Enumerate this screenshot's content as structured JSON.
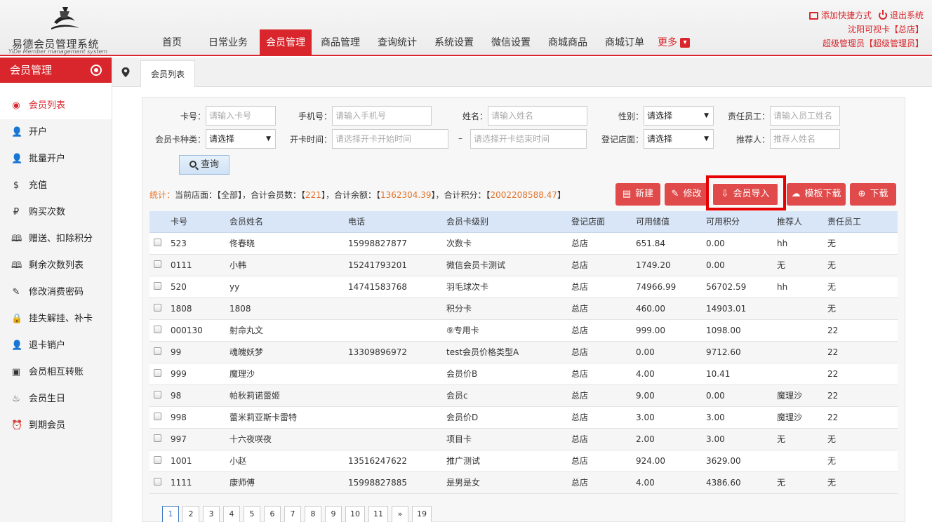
{
  "app": {
    "title": "易德会员管理系统",
    "subtitle": "YiDe Member management system"
  },
  "nav": [
    {
      "label": "首页",
      "active": false
    },
    {
      "label": "日常业务",
      "active": false
    },
    {
      "label": "会员管理",
      "active": true
    },
    {
      "label": "商品管理",
      "active": false
    },
    {
      "label": "查询统计",
      "active": false
    },
    {
      "label": "系统设置",
      "active": false
    },
    {
      "label": "微信设置",
      "active": false
    },
    {
      "label": "商城商品",
      "active": false
    },
    {
      "label": "商城订单",
      "active": false
    }
  ],
  "nav_more": "更多",
  "top_right": {
    "shortcut": "添加快捷方式",
    "logout": "退出系统",
    "store": "沈阳可视卡【总店】",
    "admin": "超级管理员【超级管理员】"
  },
  "sidebar": {
    "title": "会员管理",
    "items": [
      {
        "label": "会员列表",
        "icon": "record-icon",
        "glyph": "◉",
        "active": true
      },
      {
        "label": "开户",
        "icon": "user-icon",
        "glyph": "👤",
        "active": false
      },
      {
        "label": "批量开户",
        "icon": "user-icon",
        "glyph": "👤",
        "active": false
      },
      {
        "label": "充值",
        "icon": "coin-icon",
        "glyph": "$",
        "active": false
      },
      {
        "label": "购买次数",
        "icon": "p-coin-icon",
        "glyph": "₽",
        "active": false
      },
      {
        "label": "赠送、扣除积分",
        "icon": "book-icon",
        "glyph": "🕮",
        "active": false
      },
      {
        "label": "剩余次数列表",
        "icon": "book-icon",
        "glyph": "🕮",
        "active": false
      },
      {
        "label": "修改消费密码",
        "icon": "pencil-icon",
        "glyph": "✎",
        "active": false
      },
      {
        "label": "挂失解挂、补卡",
        "icon": "lock-icon",
        "glyph": "🔒",
        "active": false
      },
      {
        "label": "退卡销户",
        "icon": "user-icon",
        "glyph": "👤",
        "active": false
      },
      {
        "label": "会员相互转账",
        "icon": "image-icon",
        "glyph": "▣",
        "active": false
      },
      {
        "label": "会员生日",
        "icon": "cake-icon",
        "glyph": "♨",
        "active": false
      },
      {
        "label": "到期会员",
        "icon": "alarm-icon",
        "glyph": "⏰",
        "active": false
      }
    ]
  },
  "tab": {
    "label": "会员列表"
  },
  "filters": {
    "card_no": {
      "label": "卡号：",
      "placeholder": "请输入卡号"
    },
    "phone": {
      "label": "手机号：",
      "placeholder": "请输入手机号"
    },
    "name": {
      "label": "姓名：",
      "placeholder": "请输入姓名"
    },
    "gender": {
      "label": "性别：",
      "value": "请选择"
    },
    "staff": {
      "label": "责任员工：",
      "placeholder": "请输入员工姓名"
    },
    "card_type": {
      "label": "会员卡种类：",
      "value": "请选择"
    },
    "open_time": {
      "label": "开卡时间：",
      "start_placeholder": "请选择开卡开始时间",
      "end_placeholder": "请选择开卡结束时间",
      "sep": "–"
    },
    "store": {
      "label": "登记店面：",
      "value": "请选择"
    },
    "referrer": {
      "label": "推荐人：",
      "placeholder": "推荐人姓名"
    },
    "query_button": "查询"
  },
  "stats": {
    "label": "统计：",
    "store_text": "当前店面：【全部】，合计会员数：【",
    "member_count": "221",
    "balance_text": "】，合计余额：【",
    "balance": "1362304.39",
    "points_text": "】，合计积分：【",
    "points": "2002208588.47",
    "end": "】"
  },
  "actions": {
    "new": "新建",
    "edit": "修改",
    "import": "会员导入",
    "template": "模板下载",
    "download": "下载"
  },
  "table": {
    "headers": [
      "卡号",
      "会员姓名",
      "电话",
      "会员卡级别",
      "登记店面",
      "可用储值",
      "可用积分",
      "推荐人",
      "责任员工"
    ],
    "rows": [
      [
        "523",
        "佟春晓",
        "15998827877",
        "次数卡",
        "总店",
        "651.84",
        "0.00",
        "hh",
        "无"
      ],
      [
        "0111",
        "小韩",
        "15241793201",
        "微信会员卡测试",
        "总店",
        "1749.20",
        "0.00",
        "无",
        "无"
      ],
      [
        "520",
        "yy",
        "14741583768",
        "羽毛球次卡",
        "总店",
        "74966.99",
        "56702.59",
        "hh",
        "无"
      ],
      [
        "1808",
        "1808",
        "",
        "积分卡",
        "总店",
        "460.00",
        "14903.01",
        "",
        "无"
      ],
      [
        "000130",
        "射命丸文",
        "",
        "⑨专用卡",
        "总店",
        "999.00",
        "1098.00",
        "",
        "22"
      ],
      [
        "99",
        "魂魄妖梦",
        "13309896972",
        "test会员价格类型A",
        "总店",
        "0.00",
        "9712.60",
        "",
        "22"
      ],
      [
        "999",
        "魔理沙",
        "",
        "会员价B",
        "总店",
        "4.00",
        "10.41",
        "",
        "22"
      ],
      [
        "98",
        "帕秋莉诺蕾姬",
        "",
        "会员c",
        "总店",
        "9.00",
        "0.00",
        "魔理沙",
        "22"
      ],
      [
        "998",
        "蕾米莉亚斯卡雷特",
        "",
        "会员价D",
        "总店",
        "3.00",
        "3.00",
        "魔理沙",
        "22"
      ],
      [
        "997",
        "十六夜咲夜",
        "",
        "项目卡",
        "总店",
        "2.00",
        "3.00",
        "无",
        "无"
      ],
      [
        "1001",
        "小赵",
        "13516247622",
        "推广测试",
        "总店",
        "924.00",
        "3629.00",
        "",
        "无"
      ],
      [
        "1111",
        "康师傅",
        "15998827885",
        "是男是女",
        "总店",
        "4.00",
        "4386.60",
        "无",
        "无"
      ]
    ]
  },
  "pager": [
    "1",
    "2",
    "3",
    "4",
    "5",
    "6",
    "7",
    "8",
    "9",
    "10",
    "11",
    "»",
    "19"
  ],
  "colors": {
    "brand": "#d9262c",
    "accent": "#e04a4a",
    "stat": "#e4742c",
    "header_row": "#d8e6f8"
  }
}
